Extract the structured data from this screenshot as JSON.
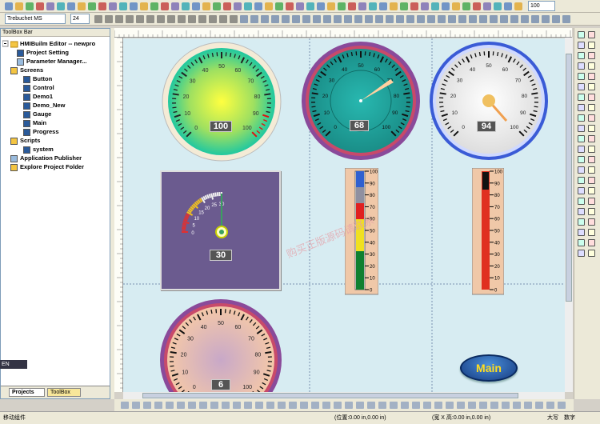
{
  "toolbar": {
    "font_name": "Trebuchet MS",
    "font_size": "24",
    "zoom": "100"
  },
  "toolbox": {
    "title": "ToolBox Bar",
    "root": "HMIBuilm Editor -- newpro",
    "items": [
      {
        "label": "Project Setting"
      },
      {
        "label": "Parameter Manager..."
      },
      {
        "label": "Screens"
      },
      {
        "label": "Button"
      },
      {
        "label": "Control"
      },
      {
        "label": "Demo1"
      },
      {
        "label": "Demo_New"
      },
      {
        "label": "Gauge"
      },
      {
        "label": "Main"
      },
      {
        "label": "Progress"
      },
      {
        "label": "Scripts"
      },
      {
        "label": "system"
      },
      {
        "label": "Application Publisher"
      },
      {
        "label": "Explore Project Folder"
      }
    ],
    "tabs": [
      "Projects",
      "ToolBox"
    ],
    "lang": "EN"
  },
  "gauges": {
    "g1": {
      "value": "100"
    },
    "g2": {
      "value": "68"
    },
    "g3": {
      "value": "94"
    },
    "g4": {
      "value": "30"
    },
    "g5": {
      "value": "6"
    }
  },
  "main_button": {
    "label": "Main"
  },
  "status": {
    "left": "移动组件",
    "position": "(位置:0.00 in,0.00 in)",
    "size": "(宽 X 高:0.00 in,0.00 in)",
    "caps": "大写",
    "num": "数字"
  },
  "watermark": "购买正版源码请联系"
}
